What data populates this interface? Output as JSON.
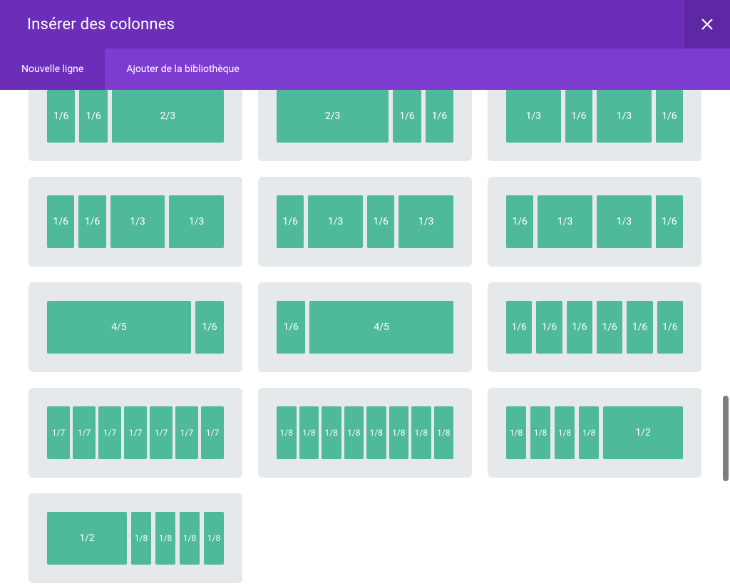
{
  "header": {
    "title": "Insérer des colonnes"
  },
  "tabs": {
    "new_line": "Nouvelle ligne",
    "add_library": "Ajouter de la bibliothèque"
  },
  "layouts": [
    {
      "row": 0,
      "segments": [
        {
          "label": "1/6",
          "w": 1
        },
        {
          "label": "1/6",
          "w": 1
        },
        {
          "label": "2/3",
          "w": 4
        }
      ]
    },
    {
      "row": 0,
      "segments": [
        {
          "label": "2/3",
          "w": 4
        },
        {
          "label": "1/6",
          "w": 1
        },
        {
          "label": "1/6",
          "w": 1
        }
      ]
    },
    {
      "row": 0,
      "segments": [
        {
          "label": "1/3",
          "w": 2
        },
        {
          "label": "1/6",
          "w": 1
        },
        {
          "label": "1/3",
          "w": 2
        },
        {
          "label": "1/6",
          "w": 1
        }
      ]
    },
    {
      "row": 1,
      "segments": [
        {
          "label": "1/6",
          "w": 1
        },
        {
          "label": "1/6",
          "w": 1
        },
        {
          "label": "1/3",
          "w": 2
        },
        {
          "label": "1/3",
          "w": 2
        }
      ]
    },
    {
      "row": 1,
      "segments": [
        {
          "label": "1/6",
          "w": 1
        },
        {
          "label": "1/3",
          "w": 2
        },
        {
          "label": "1/6",
          "w": 1
        },
        {
          "label": "1/3",
          "w": 2
        }
      ]
    },
    {
      "row": 1,
      "segments": [
        {
          "label": "1/6",
          "w": 1
        },
        {
          "label": "1/3",
          "w": 2
        },
        {
          "label": "1/3",
          "w": 2
        },
        {
          "label": "1/6",
          "w": 1
        }
      ]
    },
    {
      "row": 2,
      "segments": [
        {
          "label": "4/5",
          "w": 5
        },
        {
          "label": "1/6",
          "w": 1
        }
      ]
    },
    {
      "row": 2,
      "segments": [
        {
          "label": "1/6",
          "w": 1
        },
        {
          "label": "4/5",
          "w": 5
        }
      ]
    },
    {
      "row": 2,
      "segments": [
        {
          "label": "1/6",
          "w": 1
        },
        {
          "label": "1/6",
          "w": 1
        },
        {
          "label": "1/6",
          "w": 1
        },
        {
          "label": "1/6",
          "w": 1
        },
        {
          "label": "1/6",
          "w": 1
        },
        {
          "label": "1/6",
          "w": 1
        }
      ]
    },
    {
      "row": 3,
      "segments": [
        {
          "label": "1/7",
          "w": 1
        },
        {
          "label": "1/7",
          "w": 1
        },
        {
          "label": "1/7",
          "w": 1
        },
        {
          "label": "1/7",
          "w": 1
        },
        {
          "label": "1/7",
          "w": 1
        },
        {
          "label": "1/7",
          "w": 1
        },
        {
          "label": "1/7",
          "w": 1
        }
      ]
    },
    {
      "row": 3,
      "segments": [
        {
          "label": "1/8",
          "w": 1
        },
        {
          "label": "1/8",
          "w": 1
        },
        {
          "label": "1/8",
          "w": 1
        },
        {
          "label": "1/8",
          "w": 1
        },
        {
          "label": "1/8",
          "w": 1
        },
        {
          "label": "1/8",
          "w": 1
        },
        {
          "label": "1/8",
          "w": 1
        },
        {
          "label": "1/8",
          "w": 1
        }
      ]
    },
    {
      "row": 3,
      "segments": [
        {
          "label": "1/8",
          "w": 1
        },
        {
          "label": "1/8",
          "w": 1
        },
        {
          "label": "1/8",
          "w": 1
        },
        {
          "label": "1/8",
          "w": 1
        },
        {
          "label": "1/2",
          "w": 4
        }
      ]
    },
    {
      "row": 4,
      "segments": [
        {
          "label": "1/2",
          "w": 4
        },
        {
          "label": "1/8",
          "w": 1
        },
        {
          "label": "1/8",
          "w": 1
        },
        {
          "label": "1/8",
          "w": 1
        },
        {
          "label": "1/8",
          "w": 1
        }
      ]
    }
  ],
  "colors": {
    "header_bg": "#6C2EB9",
    "close_bg": "#5E28A4",
    "tabs_bg": "#7E3BD0",
    "card_bg": "#E6E9EC",
    "segment_bg": "#4FB99B"
  }
}
